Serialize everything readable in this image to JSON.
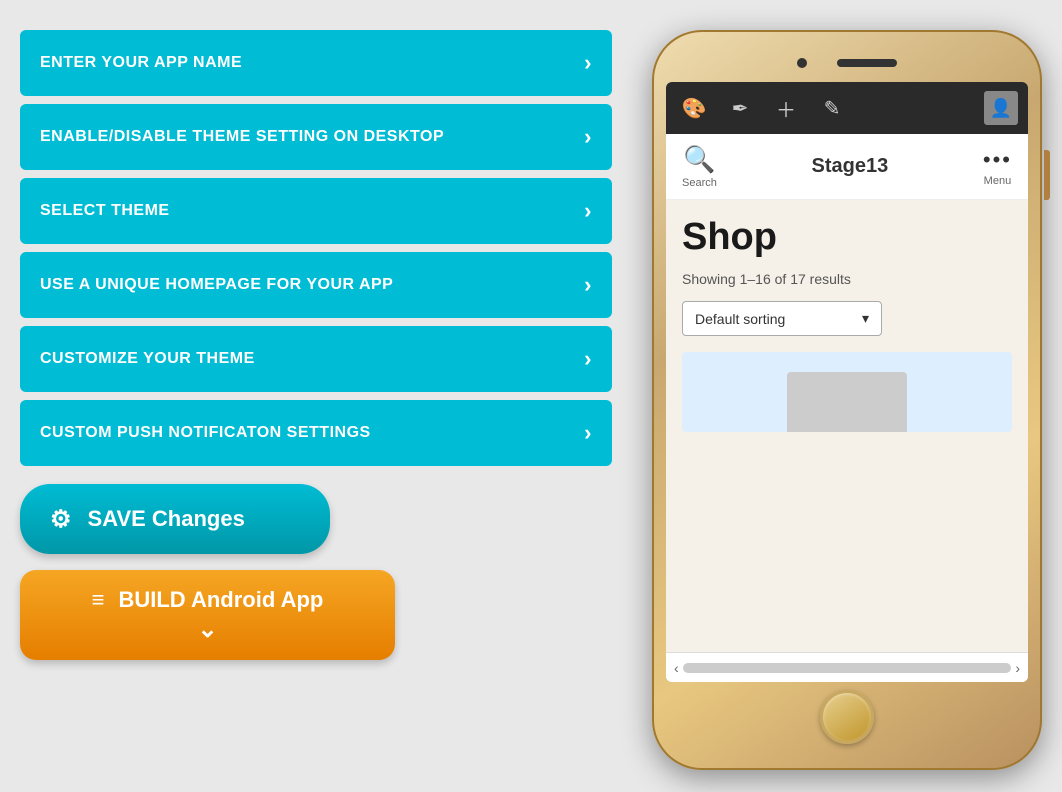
{
  "left": {
    "menu_items": [
      {
        "id": "app-name",
        "label": "ENTER YOUR APP NAME"
      },
      {
        "id": "theme-setting",
        "label": "ENABLE/DISABLE THEME SETTING ON DESKTOP"
      },
      {
        "id": "select-theme",
        "label": "SELECT THEME"
      },
      {
        "id": "unique-homepage",
        "label": "USE A UNIQUE HOMEPAGE FOR YOUR APP"
      },
      {
        "id": "customize-theme",
        "label": "CUSTOMIZE YOUR THEME"
      },
      {
        "id": "push-notifications",
        "label": "CUSTOM PUSH NOTIFICATON SETTINGS"
      }
    ],
    "save_button": {
      "icon": "≡",
      "label_bold": "SAVE",
      "label_normal": " Changes"
    },
    "build_button": {
      "icon": "≡",
      "label_bold": "BUILD",
      "label_normal": " Android App",
      "chevron": "⌄"
    }
  },
  "phone": {
    "toolbar": {
      "icons": [
        "🎨",
        "✏️",
        "➕",
        "📝"
      ],
      "avatar_emoji": "👤"
    },
    "nav": {
      "search_label": "Search",
      "site_title": "Stage13",
      "menu_label": "Menu"
    },
    "content": {
      "page_title": "Shop",
      "result_count": "Showing 1–16 of 17 results",
      "sort_label": "Default sorting",
      "sort_arrow": "▾"
    }
  }
}
